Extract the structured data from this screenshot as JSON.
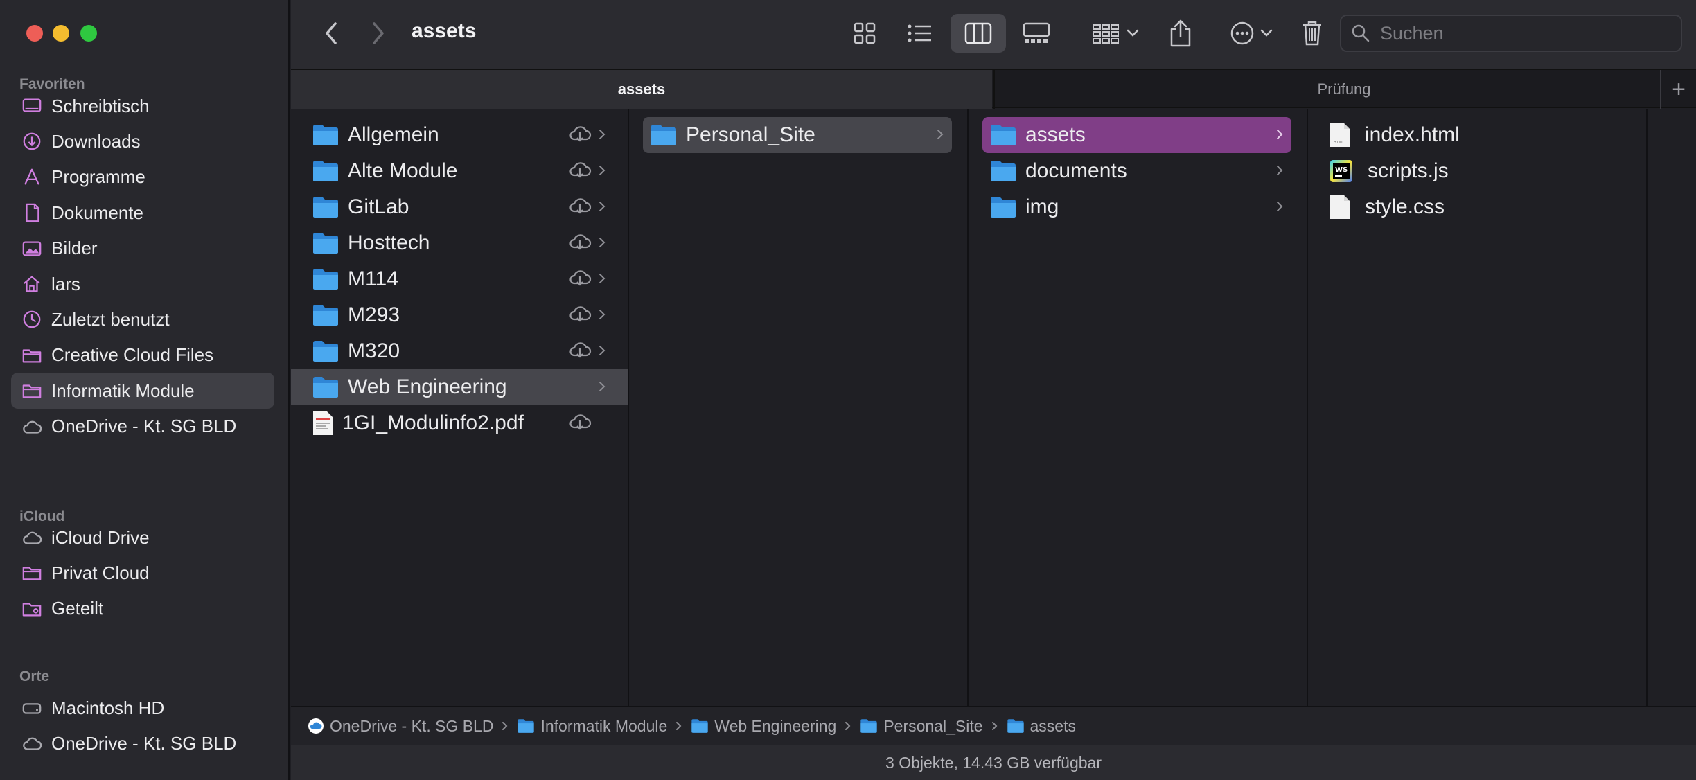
{
  "window": {
    "title": "assets"
  },
  "sidebar": {
    "favorites_title": "Favoriten",
    "favorites": [
      {
        "label": "Schreibtisch",
        "icon": "desktop-icon"
      },
      {
        "label": "Downloads",
        "icon": "downloads-icon"
      },
      {
        "label": "Programme",
        "icon": "applications-icon"
      },
      {
        "label": "Dokumente",
        "icon": "document-icon"
      },
      {
        "label": "Bilder",
        "icon": "photo-icon"
      },
      {
        "label": "lars",
        "icon": "home-icon"
      },
      {
        "label": "Zuletzt benutzt",
        "icon": "clock-icon"
      },
      {
        "label": "Creative Cloud Files",
        "icon": "folder-icon"
      },
      {
        "label": "Informatik Module",
        "icon": "folder-icon",
        "selected": true
      },
      {
        "label": "OneDrive - Kt. SG BLD",
        "icon": "cloud-icon"
      }
    ],
    "icloud_title": "iCloud",
    "icloud": [
      {
        "label": "iCloud Drive",
        "icon": "cloud-icon"
      },
      {
        "label": "Privat Cloud",
        "icon": "folder-icon"
      },
      {
        "label": "Geteilt",
        "icon": "shared-folder-icon"
      }
    ],
    "places_title": "Orte",
    "places": [
      {
        "label": "Macintosh HD",
        "icon": "disk-icon"
      },
      {
        "label": "OneDrive - Kt. SG BLD",
        "icon": "cloud-icon"
      }
    ]
  },
  "toolbar": {
    "search_placeholder": "Suchen"
  },
  "tabs": {
    "active": "assets",
    "inactive": "Prüfung",
    "add": "+"
  },
  "columns": {
    "col1": [
      {
        "label": "Allgemein",
        "type": "folder",
        "cloud": true,
        "chevron": true
      },
      {
        "label": "Alte Module",
        "type": "folder",
        "cloud": true,
        "chevron": true
      },
      {
        "label": "GitLab",
        "type": "folder",
        "cloud": true,
        "chevron": true
      },
      {
        "label": "Hosttech",
        "type": "folder",
        "cloud": true,
        "chevron": true
      },
      {
        "label": "M114",
        "type": "folder",
        "cloud": true,
        "chevron": true
      },
      {
        "label": "M293",
        "type": "folder",
        "cloud": true,
        "chevron": true
      },
      {
        "label": "M320",
        "type": "folder",
        "cloud": true,
        "chevron": true
      },
      {
        "label": "Web Engineering",
        "type": "folder",
        "cloud": false,
        "chevron": true,
        "selected": true
      },
      {
        "label": "1GI_Modulinfo2.pdf",
        "type": "pdf",
        "cloud": true,
        "chevron": false
      }
    ],
    "col2": [
      {
        "label": "Personal_Site",
        "type": "folder",
        "chevron": true,
        "selected": true
      }
    ],
    "col3": [
      {
        "label": "assets",
        "type": "folder",
        "chevron": true,
        "selected": true
      },
      {
        "label": "documents",
        "type": "folder",
        "chevron": true
      },
      {
        "label": "img",
        "type": "folder",
        "chevron": true
      }
    ],
    "col4": [
      {
        "label": "index.html",
        "type": "html"
      },
      {
        "label": "scripts.js",
        "type": "js"
      },
      {
        "label": "style.css",
        "type": "css"
      }
    ]
  },
  "pathbar": [
    {
      "label": "OneDrive - Kt. SG BLD",
      "icon": "onedrive-icon"
    },
    {
      "label": "Informatik Module",
      "icon": "folder-icon"
    },
    {
      "label": "Web Engineering",
      "icon": "folder-icon"
    },
    {
      "label": "Personal_Site",
      "icon": "folder-icon"
    },
    {
      "label": "assets",
      "icon": "folder-icon"
    }
  ],
  "status": "3 Objekte, 14.43 GB verfügbar",
  "colors": {
    "accent_purple": "#803e87",
    "folder_blue": "#4aa8ef",
    "sidebar_icon": "#d07fe0"
  }
}
